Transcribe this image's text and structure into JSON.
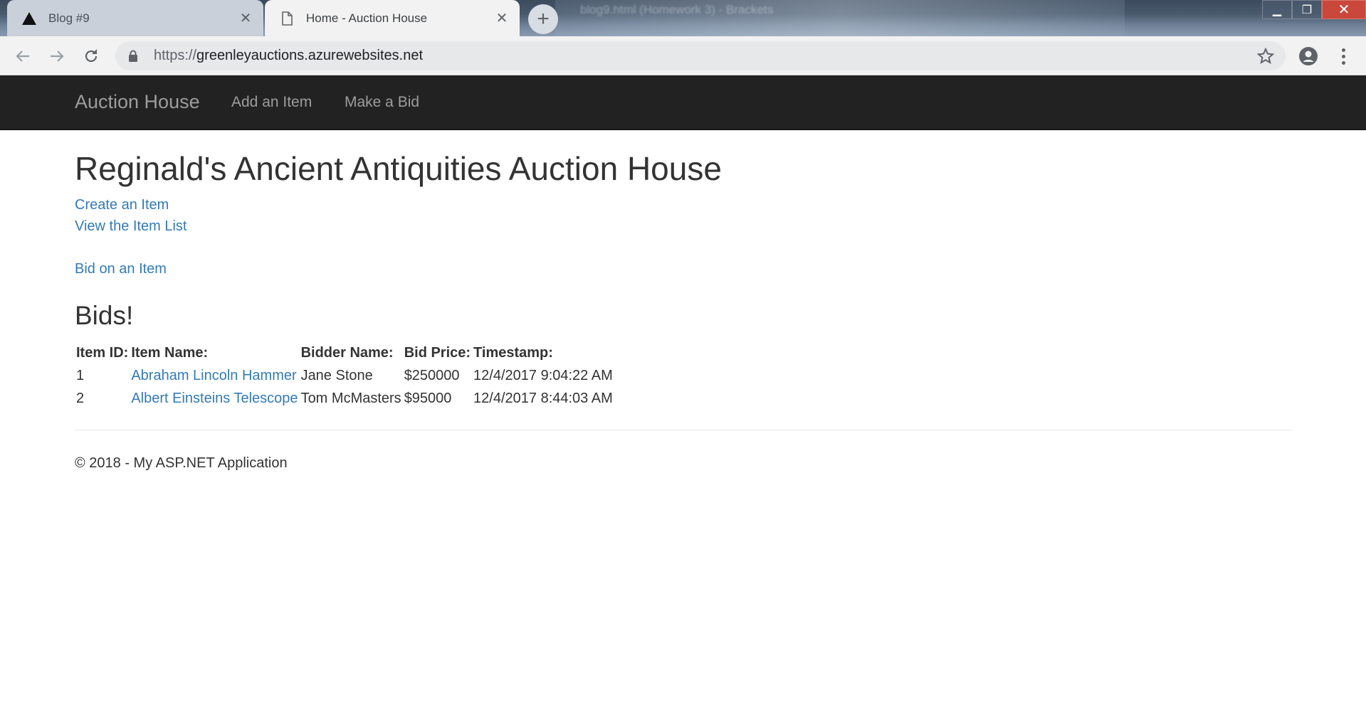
{
  "browser": {
    "tabs": [
      {
        "title": "Blog #9",
        "icon": "triangle-logo-icon"
      },
      {
        "title": "Home - Auction House",
        "icon": "page-icon"
      }
    ],
    "background_window_title": "blog9.html (Homework 3) - Brackets",
    "url_scheme": "https://",
    "url_host": "greenleyauctions.azurewebsites.net",
    "accent_color": "#337ab7"
  },
  "navbar": {
    "brand": "Auction House",
    "links": [
      "Add an Item",
      "Make a Bid"
    ]
  },
  "main": {
    "title": "Reginald's Ancient Antiquities Auction House",
    "links": {
      "create": "Create an Item",
      "view": "View the Item List",
      "bid": "Bid on an Item"
    },
    "bids_heading": "Bids!",
    "table": {
      "headers": [
        "Item ID:",
        "Item Name:",
        "Bidder Name:",
        "Bid Price:",
        "Timestamp:"
      ],
      "rows": [
        {
          "id": "1",
          "name": "Abraham Lincoln Hammer",
          "bidder": "Jane Stone",
          "price": "$250000",
          "timestamp": "12/4/2017 9:04:22 AM"
        },
        {
          "id": "2",
          "name": "Albert Einsteins Telescope",
          "bidder": "Tom McMasters",
          "price": "$95000",
          "timestamp": "12/4/2017 8:44:03 AM"
        }
      ]
    }
  },
  "footer": {
    "text": "© 2018 - My ASP.NET Application"
  }
}
